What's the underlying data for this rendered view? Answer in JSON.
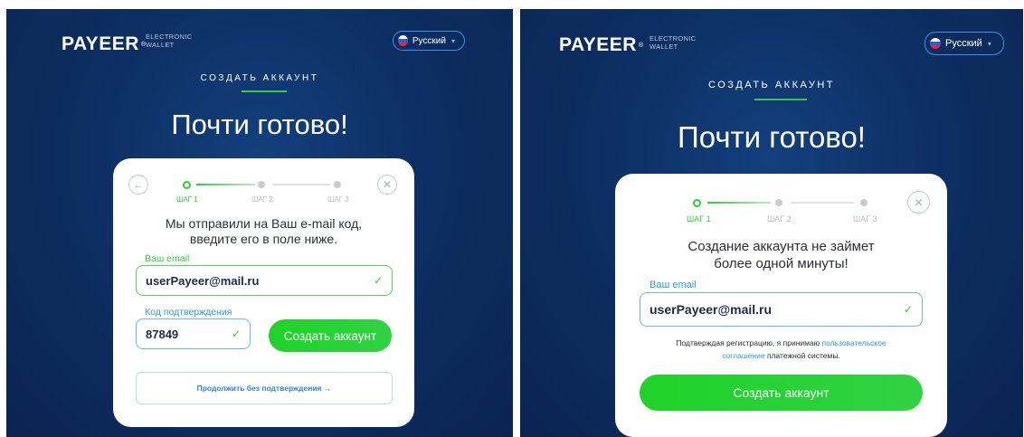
{
  "colors": {
    "bg_dark": "#0d2f63",
    "accent_green": "#2ccf3a",
    "accent_blue": "#2f9be3",
    "card": "#ffffff"
  },
  "brand": {
    "name": "PAYEER",
    "reg_mark": "®",
    "tagline_line1": "ELECTRONIC",
    "tagline_line2": "WALLET"
  },
  "language": {
    "selected": "Русский",
    "flag_icon": "russia-flag-icon",
    "caret_icon": "chevron-down-icon"
  },
  "header": {
    "subtitle": "СОЗДАТЬ АККАУНТ",
    "title": "Почти готово!"
  },
  "steps": [
    "ШАГ 1",
    "ШАГ 2",
    "ШАГ 3"
  ],
  "left": {
    "message_line1": "Мы отправили на Ваш e-mail код,",
    "message_line2": "введите его в поле ниже.",
    "email_label": "Ваш email",
    "email_value": "userPayeer@mail.ru",
    "code_label": "Код подтверждения",
    "code_value": "87849",
    "create_button": "Создать аккаунт",
    "skip_button": "Продолжить без подтверждения →",
    "back_icon": "arrow-left-icon",
    "close_icon": "close-icon"
  },
  "right": {
    "message_line1": "Создание аккаунта не займет",
    "message_line2": "более одной минуты!",
    "email_label": "Ваш email",
    "email_value": "userPayeer@mail.ru",
    "terms_prefix": "Подтверждая регистрацию, я принимаю",
    "terms_link1": "пользовательское",
    "terms_link2": "соглашение",
    "terms_suffix": "платежной системы.",
    "create_button": "Создать аккаунт",
    "close_icon": "close-icon"
  }
}
